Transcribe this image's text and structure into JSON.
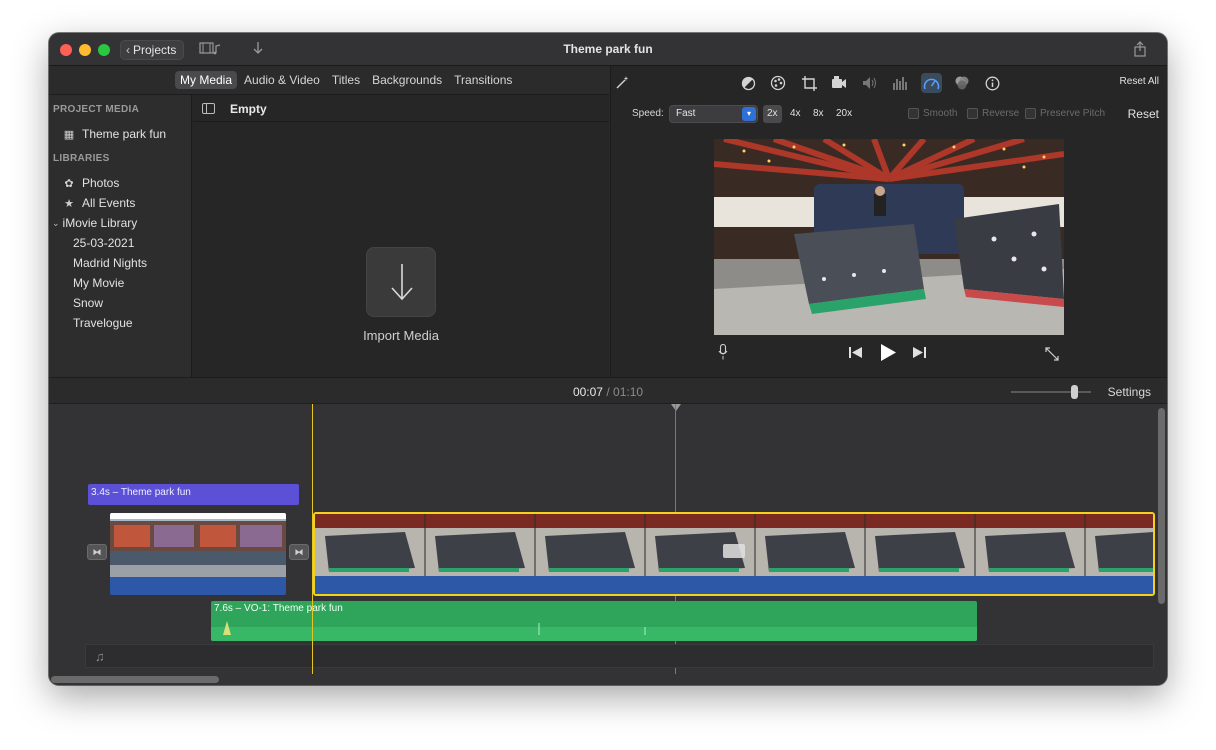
{
  "window": {
    "title": "Theme park fun"
  },
  "toolbar": {
    "projects_label": "Projects"
  },
  "media_tabs": [
    "My Media",
    "Audio & Video",
    "Titles",
    "Backgrounds",
    "Transitions"
  ],
  "sidebar": {
    "project_media_header": "PROJECT MEDIA",
    "project_item": "Theme park fun",
    "libraries_header": "LIBRARIES",
    "items": [
      "Photos",
      "All Events"
    ],
    "library": "iMovie Library",
    "events": [
      "25-03-2021",
      "Madrid Nights",
      "My Movie",
      "Snow",
      "Travelogue"
    ]
  },
  "browser": {
    "content_title": "Empty",
    "import_label": "Import Media"
  },
  "adjustments": {
    "reset_all": "Reset All",
    "speed_label": "Speed:",
    "speed_value": "Fast",
    "multipliers": [
      "2x",
      "4x",
      "8x",
      "20x"
    ],
    "checkboxes": [
      "Smooth",
      "Reverse",
      "Preserve Pitch"
    ],
    "reset": "Reset"
  },
  "timeline": {
    "current_time": "00:07",
    "separator": "/",
    "total_time": "01:10",
    "settings_label": "Settings",
    "title_clip": "3.4s – Theme park fun",
    "audio_clip": "7.6s – VO-1: Theme park fun"
  },
  "colors": {
    "title_clip": "#5b50d6",
    "audio_clip": "#2ea55a",
    "selection": "#f3d21e",
    "accent": "#2f6fd8"
  }
}
